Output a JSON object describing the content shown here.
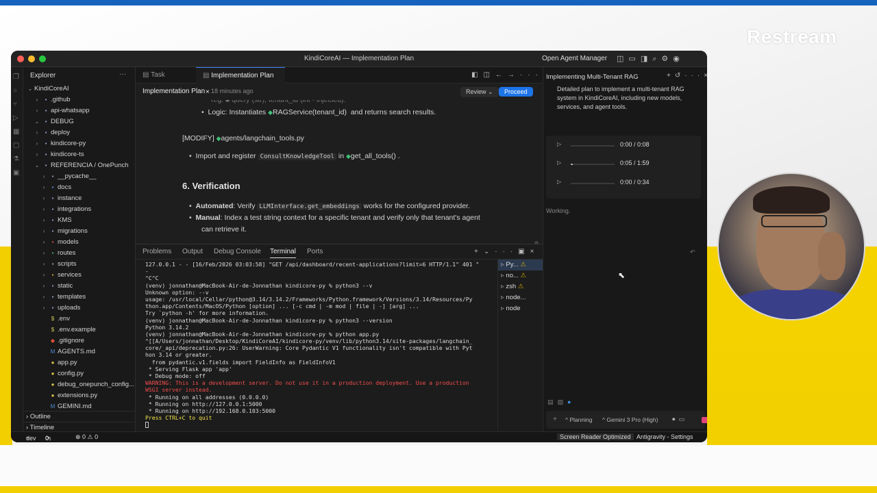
{
  "brand": "Restream",
  "window": {
    "title": "KindiCoreAI — Implementation Plan",
    "open_agent_manager": "Open Agent Manager"
  },
  "sidebar": {
    "title": "Explorer",
    "items": [
      {
        "label": "KindiCoreAI",
        "depth": 0,
        "chev": "v",
        "icon": ""
      },
      {
        "label": ".github",
        "depth": 1,
        "chev": ">",
        "icon": "▪",
        "iconColor": "#8aa0c0"
      },
      {
        "label": "api-whatsapp",
        "depth": 1,
        "chev": ">",
        "icon": "▪",
        "iconColor": "#8aa0c0"
      },
      {
        "label": "DEBUG",
        "depth": 1,
        "chev": "v",
        "icon": "▪",
        "iconColor": "#8aa0c0"
      },
      {
        "label": "deploy",
        "depth": 1,
        "chev": ">",
        "icon": "▪",
        "iconColor": "#8aa0c0"
      },
      {
        "label": "kindicore-py",
        "depth": 1,
        "chev": ">",
        "icon": "▪",
        "iconColor": "#8aa0c0"
      },
      {
        "label": "kindicore-ts",
        "depth": 1,
        "chev": ">",
        "icon": "▪",
        "iconColor": "#8aa0c0"
      },
      {
        "label": "REFERENCIA / OnePunch",
        "depth": 1,
        "chev": "v",
        "icon": "▪",
        "iconColor": "#8aa0c0"
      },
      {
        "label": "__pycache__",
        "depth": 2,
        "chev": ">",
        "icon": "▪",
        "iconColor": "#8aa0c0"
      },
      {
        "label": "docs",
        "depth": 2,
        "chev": ">",
        "icon": "▪",
        "iconColor": "#4e8fd4"
      },
      {
        "label": "instance",
        "depth": 2,
        "chev": ">",
        "icon": "▪",
        "iconColor": "#8aa0c0"
      },
      {
        "label": "integrations",
        "depth": 2,
        "chev": ">",
        "icon": "▪",
        "iconColor": "#8aa0c0"
      },
      {
        "label": "KMS",
        "depth": 2,
        "chev": ">",
        "icon": "▪",
        "iconColor": "#8aa0c0"
      },
      {
        "label": "migrations",
        "depth": 2,
        "chev": ">",
        "icon": "▪",
        "iconColor": "#8aa0c0"
      },
      {
        "label": "models",
        "depth": 2,
        "chev": ">",
        "icon": "▪",
        "iconColor": "#d0553f"
      },
      {
        "label": "routes",
        "depth": 2,
        "chev": ">",
        "icon": "▪",
        "iconColor": "#4fae6a"
      },
      {
        "label": "scripts",
        "depth": 2,
        "chev": ">",
        "icon": "▪",
        "iconColor": "#8aa0c0"
      },
      {
        "label": "services",
        "depth": 2,
        "chev": ">",
        "icon": "▪",
        "iconColor": "#d0a93f"
      },
      {
        "label": "static",
        "depth": 2,
        "chev": ">",
        "icon": "▪",
        "iconColor": "#8aa0c0"
      },
      {
        "label": "templates",
        "depth": 2,
        "chev": ">",
        "icon": "▪",
        "iconColor": "#8aa0c0"
      },
      {
        "label": "uploads",
        "depth": 2,
        "chev": ">",
        "icon": "▪",
        "iconColor": "#8aa0c0"
      },
      {
        "label": ".env",
        "depth": 2,
        "chev": "",
        "icon": "$",
        "iconColor": "#d4c95a"
      },
      {
        "label": ".env.example",
        "depth": 2,
        "chev": "",
        "icon": "$",
        "iconColor": "#d4c95a"
      },
      {
        "label": ".gitignore",
        "depth": 2,
        "chev": "",
        "icon": "◆",
        "iconColor": "#e0503a"
      },
      {
        "label": "AGENTS.md",
        "depth": 2,
        "chev": "",
        "icon": "M",
        "iconColor": "#4e8fd4"
      },
      {
        "label": "app.py",
        "depth": 2,
        "chev": "",
        "icon": "●",
        "iconColor": "#d8c24a"
      },
      {
        "label": "config.py",
        "depth": 2,
        "chev": "",
        "icon": "●",
        "iconColor": "#d8c24a"
      },
      {
        "label": "debug_onepunch_config...",
        "depth": 2,
        "chev": "",
        "icon": "●",
        "iconColor": "#d8c24a"
      },
      {
        "label": "extensions.py",
        "depth": 2,
        "chev": "",
        "icon": "●",
        "iconColor": "#d8c24a"
      },
      {
        "label": "GEMINI.md",
        "depth": 2,
        "chev": "",
        "icon": "M",
        "iconColor": "#4e8fd4"
      }
    ],
    "outline": "Outline",
    "timeline": "Timeline"
  },
  "editor": {
    "tabs": [
      "Task",
      "Implementation Plan"
    ],
    "header_title": "Implementation Plan",
    "header_time": "18 minutes ago",
    "review": "Review",
    "proceed": "Proceed",
    "logic_label": "Logic:",
    "logic_text": "Instantiates",
    "logic_code": "RAGService(tenant_id)",
    "logic_tail": "and returns search results.",
    "modify_tag": "[MODIFY]",
    "modify_file": "agents/langchain_tools.py",
    "import_text": "Import and register",
    "import_code": "ConsultKnowledgeTool",
    "import_in": "in",
    "import_fn": "get_all_tools()",
    "import_end": ".",
    "verif_heading": "6. Verification",
    "auto_label": "Automated",
    "auto_text": ": Verify",
    "auto_code": "LLMInterface.get_embeddings",
    "auto_tail": "works for the configured provider.",
    "manual_label": "Manual",
    "manual_text": ": Index a test string context for a specific tenant and verify only that tenant's agent",
    "manual_text2": "can retrieve it."
  },
  "panel": {
    "tabs": [
      "Problems",
      "Output",
      "Debug Console",
      "Terminal",
      "Ports"
    ],
    "terminal_lines": [
      {
        "t": "127.0.0.1 - - [16/Feb/2026 03:03:58] \"GET /api/dashboard/recent-applications?limit=6 HTTP/1.1\" 401 \"",
        "c": ""
      },
      {
        "t": "-",
        "c": ""
      },
      {
        "t": "^C^C",
        "c": ""
      },
      {
        "t": "(venv) jonnathan@MacBook-Air-de-Jonnathan kindicore-py % python3 --v",
        "c": "",
        "d": "red"
      },
      {
        "t": "Unknown option: --v",
        "c": ""
      },
      {
        "t": "usage: /usr/local/Cellar/python@3.14/3.14.2/Frameworks/Python.framework/Versions/3.14/Resources/Py",
        "c": ""
      },
      {
        "t": "thon.app/Contents/MacOS/Python [option] ... [-c cmd | -m mod | file | -] [arg] ...",
        "c": ""
      },
      {
        "t": "Try `python -h' for more information.",
        "c": ""
      },
      {
        "t": "(venv) jonnathan@MacBook-Air-de-Jonnathan kindicore-py % python3 --version",
        "c": "",
        "d": "blue"
      },
      {
        "t": "Python 3.14.2",
        "c": ""
      },
      {
        "t": "(venv) jonnathan@MacBook-Air-de-Jonnathan kindicore-py % python app.py",
        "c": "",
        "d": "gray"
      },
      {
        "t": "^[[A/Users/jonnathan/Desktop/KindiCoreAI/kindicore-py/venv/lib/python3.14/site-packages/langchain_",
        "c": ""
      },
      {
        "t": "core/_api/deprecation.py:26: UserWarning: Core Pydantic V1 functionality isn't compatible with Pyt",
        "c": ""
      },
      {
        "t": "hon 3.14 or greater.",
        "c": ""
      },
      {
        "t": "  from pydantic.v1.fields import FieldInfo as FieldInfoV1",
        "c": ""
      },
      {
        "t": " * Serving Flask app 'app'",
        "c": ""
      },
      {
        "t": " * Debug mode: off",
        "c": ""
      },
      {
        "t": "WARNING: This is a development server. Do not use it in a production deployment. Use a production",
        "c": "red"
      },
      {
        "t": "WSGI server instead.",
        "c": "red"
      },
      {
        "t": " * Running on all addresses (0.0.0.0)",
        "c": ""
      },
      {
        "t": " * Running on http://127.0.0.1:5000",
        "c": ""
      },
      {
        "t": " * Running on http://192.168.0.103:5000",
        "c": ""
      },
      {
        "t": "Press CTRL+C to quit",
        "c": "yel"
      },
      {
        "t": "",
        "c": ""
      }
    ],
    "terminals": [
      {
        "label": "Py...",
        "warn": true,
        "sel": true
      },
      {
        "label": "no...",
        "warn": true,
        "sel": false
      },
      {
        "label": "zsh",
        "warn": true,
        "sel": false
      },
      {
        "label": "node...",
        "warn": false,
        "sel": false
      },
      {
        "label": "node",
        "warn": false,
        "sel": false
      }
    ]
  },
  "agent": {
    "title": "Implementing Multi-Tenant RAG",
    "description": "Detailed plan to implement a multi-tenant RAG system in KindiCoreAI, including new models, services, and agent tools.",
    "audio": [
      {
        "time": "0:00 / 0:08",
        "progress": 0.0
      },
      {
        "time": "0:05 / 1:59",
        "progress": 0.04
      },
      {
        "time": "0:00 / 0:34",
        "progress": 0.0
      }
    ],
    "working": "Working.",
    "planning": "Planning",
    "model": "Gemini 3 Pro (High)"
  },
  "status": {
    "branch": "dev",
    "sync": "0↓ 2↑",
    "problems": "⊗ 0 ⚠ 0",
    "screen_reader": "Screen Reader Optimized",
    "settings": "Antigravity - Settings"
  },
  "colors": {
    "accent": "#1d74e8",
    "brand_bar": "#1663bd",
    "yellow": "#f1cf00"
  }
}
